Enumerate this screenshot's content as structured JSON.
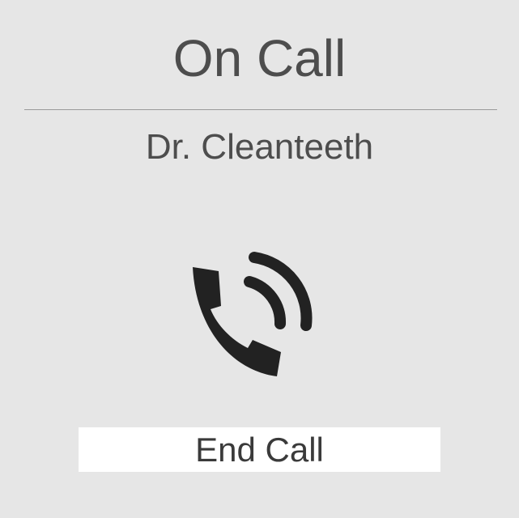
{
  "screen": {
    "title": "On Call",
    "caller_name": "Dr. Cleanteeth",
    "status_icon": "phone-call-icon",
    "end_call_label": "End Call"
  },
  "colors": {
    "background": "#e6e6e6",
    "text": "#4d4d4d",
    "icon": "#222222",
    "button_background": "#ffffff",
    "divider": "#9a9a9a"
  }
}
